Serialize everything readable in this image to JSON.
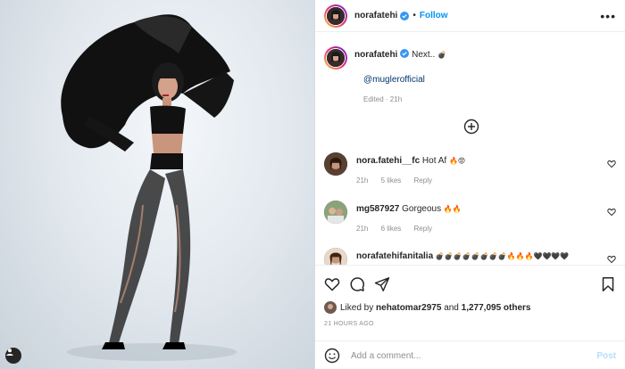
{
  "post": {
    "username": "norafatehi",
    "follow_label": "Follow",
    "more_label": "•••",
    "caption_text": "Next..",
    "caption_emoji": "💣",
    "mention": "@muglerofficial",
    "edited": "Edited · 21h"
  },
  "comments": [
    {
      "username": "nora.fatehi__fc",
      "text": "Hot Af",
      "emojis": "🔥😡",
      "time": "21h",
      "likes": "5 likes",
      "reply": "Reply"
    },
    {
      "username": "mg587927",
      "text": "Gorgeous",
      "emojis": "🔥🔥",
      "time": "21h",
      "likes": "6 likes",
      "reply": "Reply"
    },
    {
      "username": "norafatehifanitalia",
      "text": "",
      "emojis": "💣💣💣💣💣💣💣💣🔥🔥🔥🖤🖤🖤🖤",
      "time": "",
      "likes": "",
      "reply": ""
    }
  ],
  "likes": {
    "prefix": "Liked by",
    "user": "nehatomar2975",
    "and": "and",
    "count": "1,277,095 others"
  },
  "time_ago": "21 HOURS AGO",
  "comment_box": {
    "placeholder": "Add a comment...",
    "post_label": "Post"
  },
  "icons": {
    "verified": "verified-badge-icon",
    "like": "heart-icon",
    "comment": "comment-bubble-icon",
    "share": "paper-plane-icon",
    "save": "bookmark-icon",
    "emoji": "smiley-icon",
    "load_more": "plus-circle-icon"
  },
  "colors": {
    "accent": "#0095f6",
    "verified": "#3897f0",
    "post_disabled": "#b2dffc"
  }
}
